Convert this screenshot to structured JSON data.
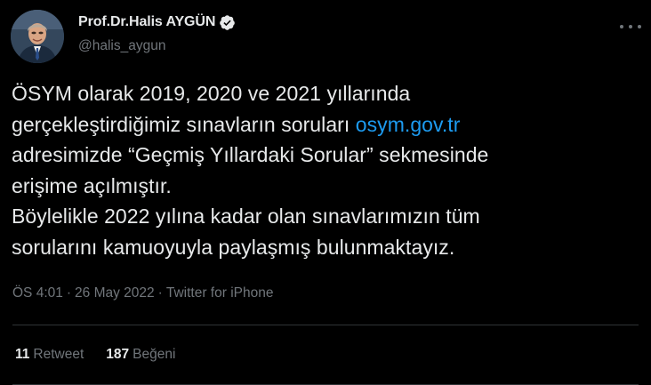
{
  "author": {
    "display_name": "Prof.Dr.Halis AYGÜN",
    "handle": "@halis_aygun",
    "verified": true
  },
  "tweet": {
    "lines": [
      {
        "text": "ÖSYM olarak 2019, 2020 ve 2021 yıllarında"
      },
      {
        "text": "gerçekleştirdiğimiz sınavların soruları ",
        "link": "osym.gov.tr"
      },
      {
        "text": "adresimizde “Geçmiş Yıllardaki Sorular” sekmesinde"
      },
      {
        "text": "erişime açılmıştır."
      },
      {
        "text": "Böylelikle 2022 yılına kadar olan sınavlarımızın tüm"
      },
      {
        "text": "sorularını kamuoyuyla paylaşmış bulunmaktayız."
      }
    ]
  },
  "meta": {
    "time": "ÖS 4:01",
    "separator": "·",
    "date": "26 May 2022",
    "source": "Twitter for iPhone"
  },
  "stats": {
    "retweets": {
      "count": "11",
      "label": "Retweet"
    },
    "likes": {
      "count": "187",
      "label": "Beğeni"
    }
  },
  "icons": {
    "verified": "verified-badge-icon",
    "more": "more-options-icon"
  },
  "colors": {
    "background": "#000000",
    "text": "#e7e9ea",
    "secondary": "#71767b",
    "link": "#1d9bf0",
    "divider": "#2f3336"
  }
}
